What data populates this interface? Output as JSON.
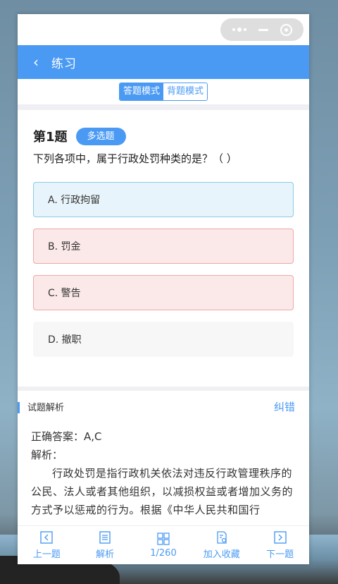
{
  "nav": {
    "title": "练习",
    "back_icon": "chevron-left-icon"
  },
  "mode": {
    "answer_mode": "答题模式",
    "recite_mode": "背题模式",
    "active": "答题模式"
  },
  "question": {
    "number": "第1题",
    "type": "多选题",
    "text": "下列各项中，属于行政处罚种类的是？（ ）",
    "options": [
      {
        "label": "A. 行政拘留",
        "state": "selected"
      },
      {
        "label": "B. 罚金",
        "state": "wrong"
      },
      {
        "label": "C. 警告",
        "state": "wrong"
      },
      {
        "label": "D. 撤职",
        "state": "plain"
      }
    ]
  },
  "analysis": {
    "title": "试题解析",
    "report_link": "纠错",
    "answer": "正确答案：A,C",
    "label": "解析：",
    "text": "行政处罚是指行政机关依法对违反行政管理秩序的公民、法人或者其他组织，以减损权益或者增加义务的方式予以惩戒的行为。根据《中华人民共和国行"
  },
  "tabbar": {
    "prev": "上一题",
    "analysis": "解析",
    "progress": "1/260",
    "favorite": "加入收藏",
    "next": "下一题"
  },
  "colors": {
    "accent": "#4a9af4",
    "selected_bg": "#e8f4fb",
    "wrong_bg": "#fbe8e8"
  }
}
